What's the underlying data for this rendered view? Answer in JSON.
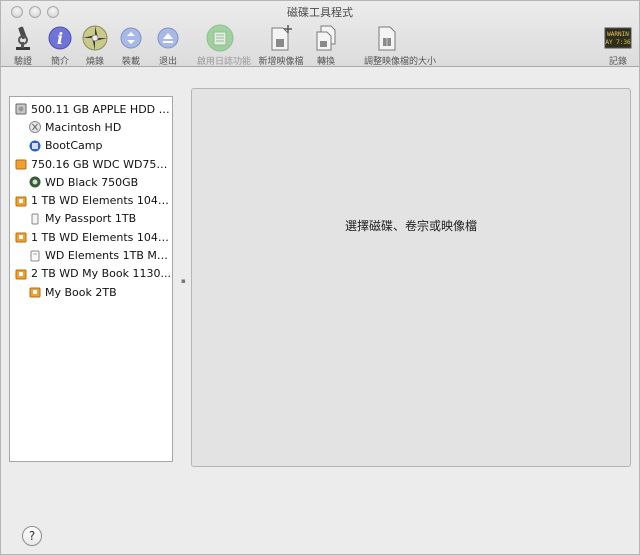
{
  "window": {
    "title": "磁碟工具程式"
  },
  "toolbar": {
    "verify": "驗證",
    "info": "簡介",
    "burn": "燒錄",
    "mount": "裝載",
    "eject": "退出",
    "journaling": "啟用日誌功能",
    "new_image": "新增映像檔",
    "convert": "轉換",
    "resize_image": "調整映像檔的大小",
    "log": "記錄",
    "log_icon_line1": "WARNIN",
    "log_icon_line2": "AY 7:36"
  },
  "sidebar": {
    "items": [
      {
        "label": "500.11 GB APPLE HDD H...",
        "icon": "internal-hdd-icon",
        "level": 0
      },
      {
        "label": "Macintosh HD",
        "icon": "macos-volume-icon",
        "level": 1
      },
      {
        "label": "BootCamp",
        "icon": "bootcamp-volume-icon",
        "level": 1
      },
      {
        "label": "750.16 GB WDC WD7500...",
        "icon": "external-orange-drive-icon",
        "level": 0
      },
      {
        "label": "WD Black 750GB",
        "icon": "wd-volume-icon",
        "level": 1
      },
      {
        "label": "1 TB WD Elements 1048...",
        "icon": "external-usb-drive-icon",
        "level": 0
      },
      {
        "label": "My Passport 1TB",
        "icon": "passport-volume-icon",
        "level": 1
      },
      {
        "label": "1 TB WD Elements 1042...",
        "icon": "external-usb-drive-icon",
        "level": 0
      },
      {
        "label": "WD Elements 1TB Music",
        "icon": "white-drive-volume-icon",
        "level": 1
      },
      {
        "label": "2 TB WD My Book 1130...",
        "icon": "external-usb-drive-icon",
        "level": 0
      },
      {
        "label": "My Book 2TB",
        "icon": "usb-volume-icon",
        "level": 1
      }
    ]
  },
  "main": {
    "placeholder": "選擇磁碟、卷宗或映像檔"
  },
  "help": {
    "label": "?"
  },
  "colors": {
    "window_bg": "#ececec",
    "panel_bg": "#e3e3e3",
    "sidebar_bg": "#ffffff",
    "orange_drive": "#f0a030"
  }
}
